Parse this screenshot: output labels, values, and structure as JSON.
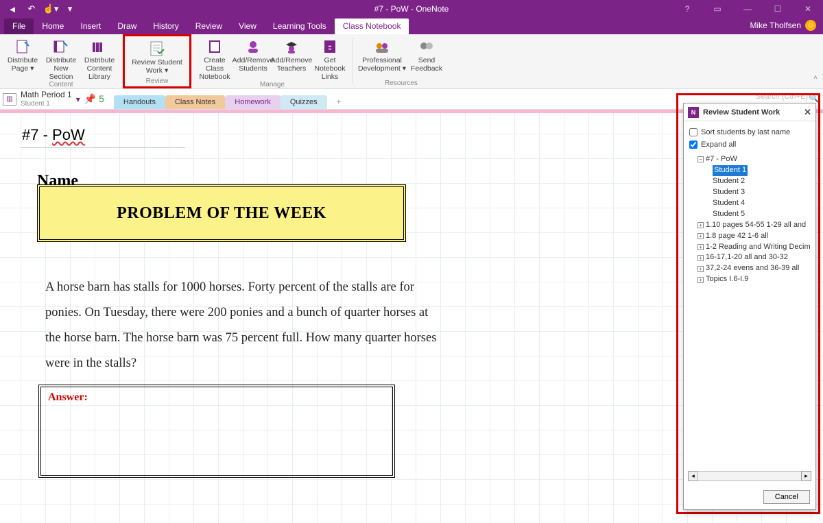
{
  "window": {
    "title": "#7 - PoW - OneNote",
    "user": "Mike Tholfsen"
  },
  "menu": {
    "file": "File",
    "home": "Home",
    "insert": "Insert",
    "draw": "Draw",
    "history": "History",
    "review": "Review",
    "view": "View",
    "learning": "Learning Tools",
    "class": "Class Notebook"
  },
  "ribbon": {
    "content_label": "Content",
    "review_label": "Review",
    "manage_label": "Manage",
    "resources_label": "Resources",
    "btn": {
      "dist_page": "Distribute Page ▾",
      "dist_section": "Distribute New Section",
      "dist_lib": "Distribute Content Library",
      "review_work": "Review Student Work ▾",
      "create_nb": "Create Class Notebook",
      "add_students": "Add/Remove Students",
      "add_teachers": "Add/Remove Teachers",
      "nb_links": "Get Notebook Links",
      "prof_dev": "Professional Development ▾",
      "send_fb": "Send Feedback"
    }
  },
  "nav": {
    "notebook": "Math Period 1",
    "section_group": "Student 1",
    "pin": "5",
    "tabs": {
      "handouts": "Handouts",
      "classnotes": "Class Notes",
      "homework": "Homework",
      "quizzes": "Quizzes",
      "add": "+"
    },
    "search_placeholder": "Search (Ctrl+E)"
  },
  "page": {
    "title_prefix": "#7 - ",
    "title_word": "PoW",
    "name_heading": "Name",
    "pow_heading": "PROBLEM OF THE WEEK",
    "body": "A horse barn has stalls for 1000 horses. Forty percent of the stalls are for ponies. On Tuesday, there were 200 ponies and a bunch of quarter horses at the horse barn. The horse barn was 75 percent full. How many quarter horses were in the stalls?",
    "answer_label": "Answer:"
  },
  "pane": {
    "title": "Review Student Work",
    "sort_label": "Sort students by last name",
    "expand_label": "Expand all",
    "root": "#7 - PoW",
    "students": [
      "Student 1",
      "Student 2",
      "Student 3",
      "Student 4",
      "Student 5"
    ],
    "others": [
      "1.10 pages 54-55 1-29 all and",
      "1.8 page 42 1-6 all",
      "1-2 Reading and Writing Decim",
      "16-17,1-20 all and 30-32",
      "37,2-24 evens and 36-39 all",
      "Topics I.6-I.9"
    ],
    "cancel": "Cancel"
  }
}
